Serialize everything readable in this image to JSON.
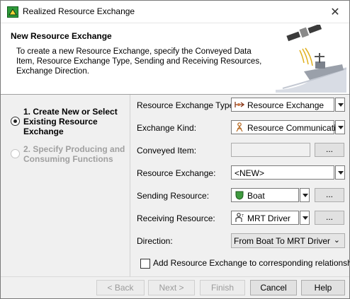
{
  "window": {
    "title": "Realized Resource Exchange",
    "close_glyph": "✕"
  },
  "header": {
    "title": "New Resource Exchange",
    "description": "To create a new Resource Exchange, specify the Conveyed Data Item, Resource Exchange Type, Sending and Receiving Resources, Exchange Direction.",
    "art_icon": "satellite-ship-icon"
  },
  "steps": [
    {
      "label": "1. Create New or Select Existing Resource Exchange",
      "selected": true
    },
    {
      "label": "2. Specify Producing and Consuming Functions",
      "selected": false
    }
  ],
  "form": {
    "resource_exchange_type": {
      "label": "Resource Exchange Type:",
      "value": "Resource Exchange",
      "icon": "resource-exchange-icon"
    },
    "exchange_kind": {
      "label": "Exchange Kind:",
      "value": "Resource Communication",
      "icon": "resource-communication-icon"
    },
    "conveyed_item": {
      "label": "Conveyed Item:",
      "value": "",
      "browse": "..."
    },
    "resource_exchange": {
      "label": "Resource Exchange:",
      "value": "<NEW>"
    },
    "sending_resource": {
      "label": "Sending Resource:",
      "value": "Boat",
      "icon": "boat-icon",
      "browse": "..."
    },
    "receiving_resource": {
      "label": "Receiving Resource:",
      "value": "MRT Driver",
      "icon": "person-icon",
      "browse": "..."
    },
    "direction": {
      "label": "Direction:",
      "value": "From Boat To MRT Driver"
    },
    "add_to_relationships": {
      "label": "Add Resource Exchange to corresponding relationships",
      "checked": false
    }
  },
  "buttons": {
    "back": "< Back",
    "next": "Next >",
    "finish": "Finish",
    "cancel": "Cancel",
    "help": "Help"
  }
}
